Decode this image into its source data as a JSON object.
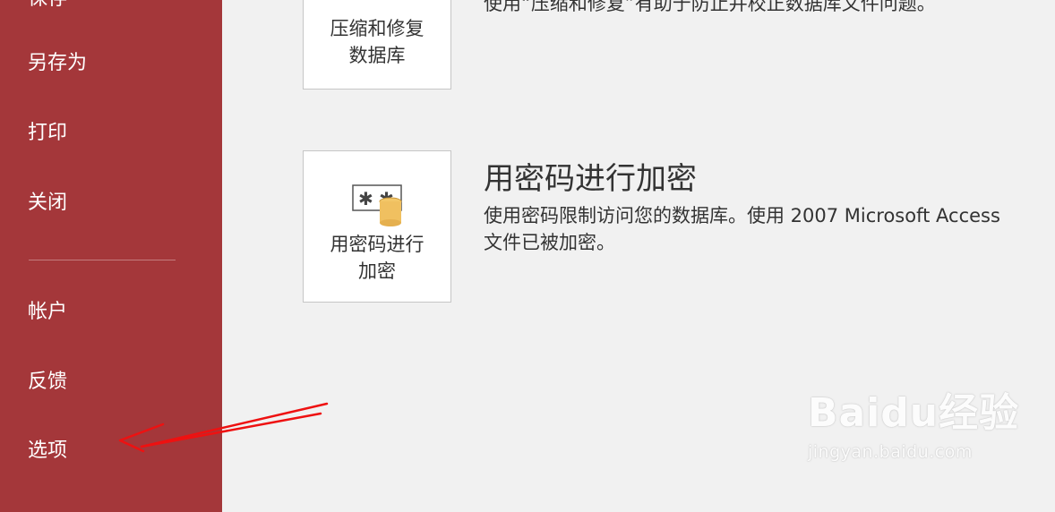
{
  "sidebar": {
    "items": [
      {
        "label": "保存"
      },
      {
        "label": "另存为"
      },
      {
        "label": "打印"
      },
      {
        "label": "关闭"
      },
      {
        "label": "帐户"
      },
      {
        "label": "反馈"
      },
      {
        "label": "选项"
      }
    ]
  },
  "main": {
    "compact_tile": {
      "label": "压缩和修复\n数据库"
    },
    "compact_desc": "使用“压缩和修复”有助于防止并校正数据库文件问题。",
    "encrypt_tile": {
      "label": "用密码进行\n加密"
    },
    "encrypt_title": "用密码进行加密",
    "encrypt_desc": "使用密码限制访问您的数据库。使用 2007 Microsoft Access\n文件已被加密。"
  },
  "watermark": {
    "logo": "Baidu经验",
    "url": "jingyan.baidu.com"
  },
  "colors": {
    "sidebar": "#a4373a",
    "background": "#f1f1f1",
    "arrow": "#ee1111"
  }
}
